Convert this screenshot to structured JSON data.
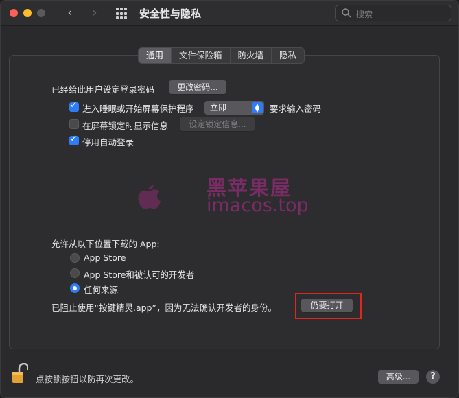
{
  "window": {
    "title": "安全性与隐私"
  },
  "search": {
    "placeholder": "搜索"
  },
  "tabs": [
    {
      "label": "通用",
      "active": true
    },
    {
      "label": "文件保险箱",
      "active": false
    },
    {
      "label": "防火墙",
      "active": false
    },
    {
      "label": "隐私",
      "active": false
    }
  ],
  "general": {
    "password_set_label": "已经给此用户设定登录密码",
    "change_password_button": "更改密码...",
    "require_password": {
      "label": "进入睡眠或开始屏幕保护程序",
      "checked": true,
      "popup_value": "立即",
      "suffix": "要求输入密码"
    },
    "show_message": {
      "label": "在屏幕锁定时显示信息",
      "checked": false,
      "button": "设定锁定信息..."
    },
    "disable_autologin": {
      "label": "停用自动登录",
      "checked": true
    }
  },
  "downloads": {
    "heading": "允许从以下位置下载的 App:",
    "options": [
      {
        "label": "App Store",
        "selected": false
      },
      {
        "label": "App Store和被认可的开发者",
        "selected": false
      },
      {
        "label": "任何来源",
        "selected": true
      }
    ],
    "blocked_message": "已阻止使用“按键精灵.app”，因为无法确认开发者的身份。",
    "open_anyway_button": "仍要打开"
  },
  "watermark": {
    "line1": "黑苹果屋",
    "line2": "imacos.top"
  },
  "footer": {
    "lock_text": "点按锁按钮以防再次更改。",
    "advanced_button": "高级...",
    "help_button": "?"
  },
  "colors": {
    "accent": "#2f7df6",
    "highlight": "#e0261d",
    "watermark": "#8c2c73"
  }
}
